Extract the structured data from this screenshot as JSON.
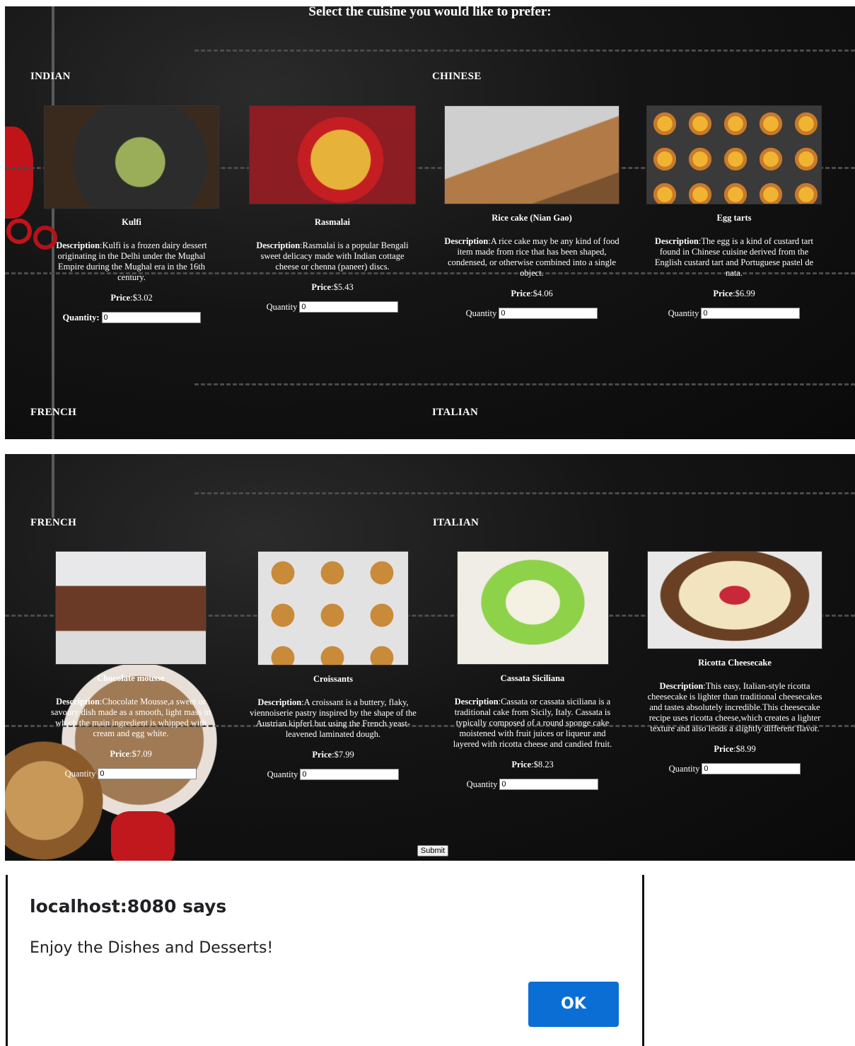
{
  "header": {
    "title": "Select the cuisine you would like to prefer:"
  },
  "labels": {
    "description": "Description",
    "price": "Price",
    "quantity": "Quantity"
  },
  "sections": {
    "indian": "INDIAN",
    "chinese": "CHINESE",
    "french": "FRENCH",
    "italian": "ITALIAN"
  },
  "items": [
    {
      "name": "Kulfi",
      "desc": "Kulfi is a frozen dairy dessert originating in the Delhi under the Mughal Empire during the Mughal era in the 16th century.",
      "price": "$3.02",
      "qty_label": "Quantity:",
      "qty": "0"
    },
    {
      "name": "Rasmalai",
      "desc": "Rasmalai is a popular Bengali sweet delicacy made with Indian cottage cheese or chenna (paneer) discs.",
      "price": "$5.43",
      "qty_label": "Quantity",
      "qty": "0"
    },
    {
      "name": "Rice cake (Nian Gao)",
      "desc": "A rice cake may be any kind of food item made from rice that has been shaped, condensed, or otherwise combined into a single object.",
      "price": "$4.06",
      "qty_label": "Quantity",
      "qty": "0"
    },
    {
      "name": "Egg tarts",
      "desc": "The egg is a kind of custard tart found in Chinese cuisine derived from the English custard tart and Portuguese pastel de nata.",
      "price": "$6.99",
      "qty_label": "Quantity",
      "qty": "0"
    },
    {
      "name": "Chocolate mousse",
      "desc": "Chocolate Mousse,a sweet or savoury dish made as a smooth, light mass in which the main ingredient is whipped with cream and egg white.",
      "price": "$7.09",
      "qty_label": "Quantity",
      "qty": "0"
    },
    {
      "name": "Croissants",
      "desc": "A croissant is a buttery, flaky, viennoiserie pastry inspired by the shape of the Austrian kipferl but using the French yeast-leavened laminated dough.",
      "price": "$7.99",
      "qty_label": "Quantity",
      "qty": "0"
    },
    {
      "name": "Cassata Siciliana",
      "desc": "Cassata or cassata siciliana is a traditional cake from Sicily, Italy. Cassata is typically composed of a round sponge cake moistened with fruit juices or liqueur and layered with ricotta cheese and candied fruit.",
      "price": "$8.23",
      "qty_label": "Quantity",
      "qty": "0"
    },
    {
      "name": "Ricotta Cheesecake",
      "desc": "This easy, Italian-style ricotta cheesecake is lighter than traditional cheesecakes and tastes absolutely incredible.This cheesecake recipe uses ricotta cheese,which creates a lighter texture and also lends a slightly different flavor.",
      "price": "$8.99",
      "qty_label": "Quantity",
      "qty": "0"
    }
  ],
  "submit_label": "Submit",
  "dialog": {
    "title": "localhost:8080 says",
    "message": "Enjoy the Dishes and Desserts!",
    "ok_label": "OK"
  },
  "colors": {
    "background": "#141414",
    "accent": "#0b6ed5"
  }
}
